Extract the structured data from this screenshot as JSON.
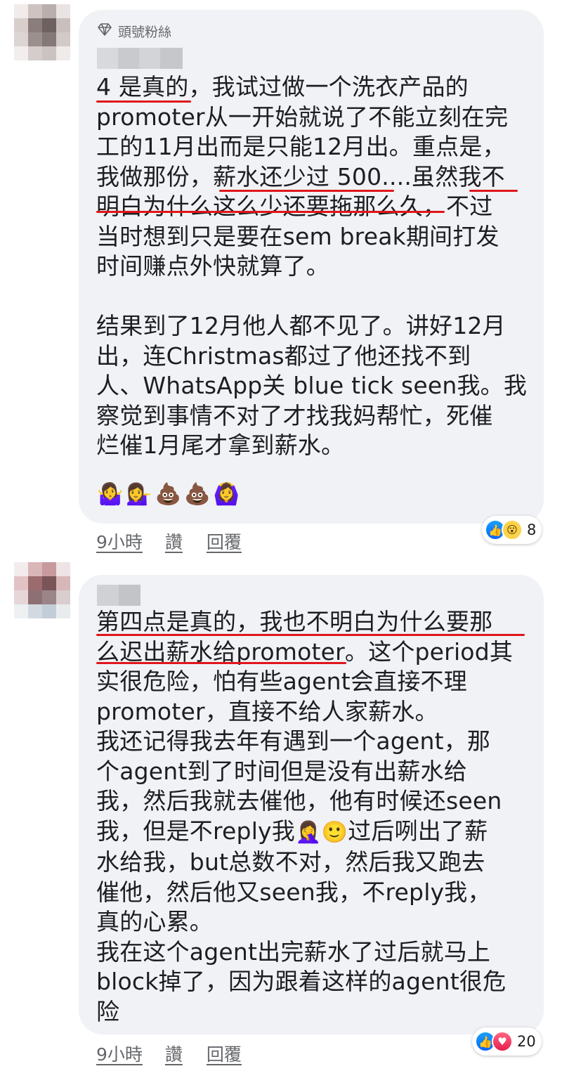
{
  "comments": [
    {
      "badge": "頭號粉絲",
      "text": "4 是真的，我试过做一个洗衣产品的\npromoter从一开始就说了不能立刻在完\n工的11月出而是只能12月出。重点是，\n我做那份，薪水还少过 500....虽然我不\n明白为什么这么少还要拖那么久，不过\n当时想到只是要在sem break期间打发\n时间赚点外快就算了。\n\n结果到了12月他人都不见了。讲好12月\n出，连Christmas都过了他还找不到\n人、WhatsApp关 blue tick seen我。我\n察觉到事情不对了才找我妈帮忙，死催\n烂催1月尾才拿到薪水。",
      "emojis": [
        "🤷‍♀️",
        "💁‍♀️",
        "💩",
        "💩",
        "🙆‍♀️"
      ],
      "time": "9小時",
      "like": "讚",
      "reply": "回覆",
      "reaction_icons": [
        "like-reaction",
        "wow-reaction"
      ],
      "reaction_count": "8"
    },
    {
      "text_lines": [
        "第四点是真的，我也不明白为什么要那",
        "么迟出薪水给promoter。这个period其",
        "实很危险，怕有些agent会直接不理",
        "promoter，直接不给人家薪水。",
        "我还记得我去年有遇到一个agent，那",
        "个agent到了时间但是没有出薪水给",
        "我，然后我就去催他，他有时候还seen",
        "我，但是不reply我",
        "水给我，but总数不对，然后我又跑去",
        "催他，然后他又seen我，不reply我，",
        "真的心累。",
        "我在这个agent出完薪水了过后就马上",
        "block掉了，因为跟着这样的agent很危",
        "险"
      ],
      "inline_emojis": [
        "🤦‍♀️",
        "🙂"
      ],
      "line8_tail": "过后咧出了薪",
      "time": "9小時",
      "like": "讚",
      "reply": "回覆",
      "reaction_icons": [
        "like-reaction",
        "love-reaction"
      ],
      "reaction_count": "20"
    }
  ],
  "colors": {
    "bubble": "#f0f2f5",
    "underline": "#e0161b",
    "meta": "#65676b"
  }
}
